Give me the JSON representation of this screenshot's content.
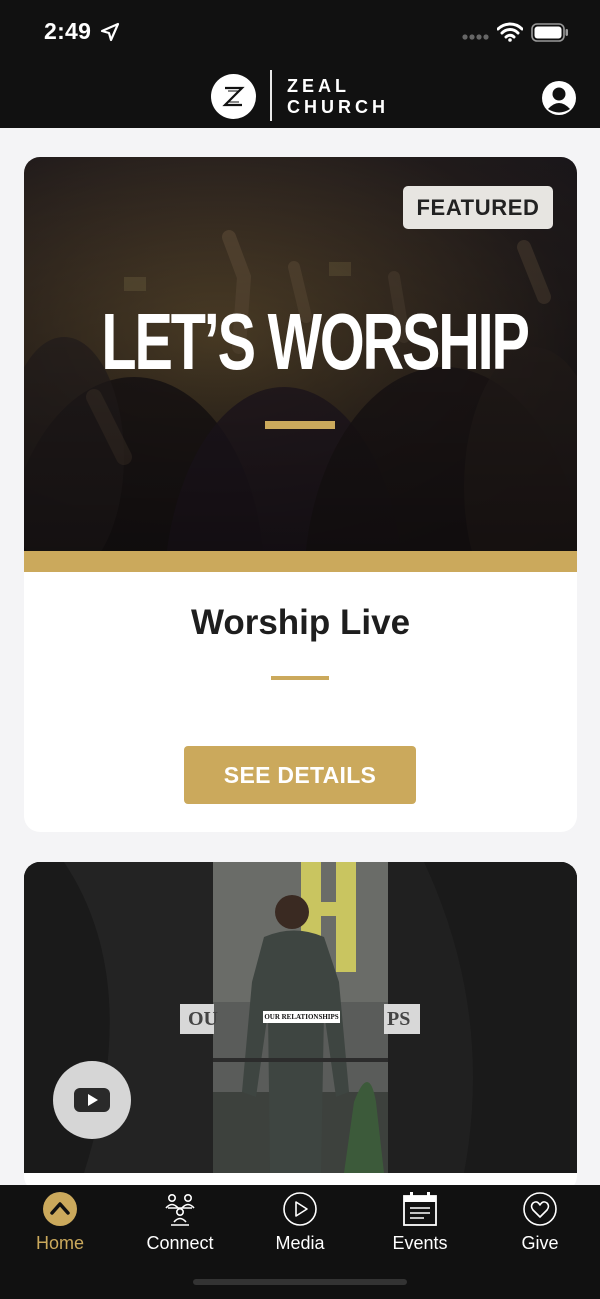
{
  "status_bar": {
    "time": "2:49",
    "icons": [
      "location-arrow-icon",
      "cellular-dots-icon",
      "wifi-icon",
      "battery-icon"
    ]
  },
  "header": {
    "logo_mark": "Z",
    "logo_line1": "ZEAL",
    "logo_line2": "CHURCH",
    "profile_icon": "user-profile-icon"
  },
  "featured_card": {
    "badge": "FEATURED",
    "hero_title": "LET’S WORSHIP",
    "title": "Worship Live",
    "button_label": "SEE DETAILS"
  },
  "video_card": {
    "lower_third": "OUR RELATIONSHIPS",
    "ghost_left": "OU",
    "ghost_right": "PS",
    "play_icon": "youtube-play-icon"
  },
  "tabs": [
    {
      "label": "Home",
      "icon": "home-chevron-icon",
      "active": true
    },
    {
      "label": "Connect",
      "icon": "people-group-icon",
      "active": false
    },
    {
      "label": "Media",
      "icon": "play-circle-icon",
      "active": false
    },
    {
      "label": "Events",
      "icon": "calendar-icon",
      "active": false
    },
    {
      "label": "Give",
      "icon": "heart-circle-icon",
      "active": false
    }
  ],
  "colors": {
    "accent": "#cba95c",
    "header_bg": "#111111",
    "page_bg": "#f4f4f6"
  }
}
